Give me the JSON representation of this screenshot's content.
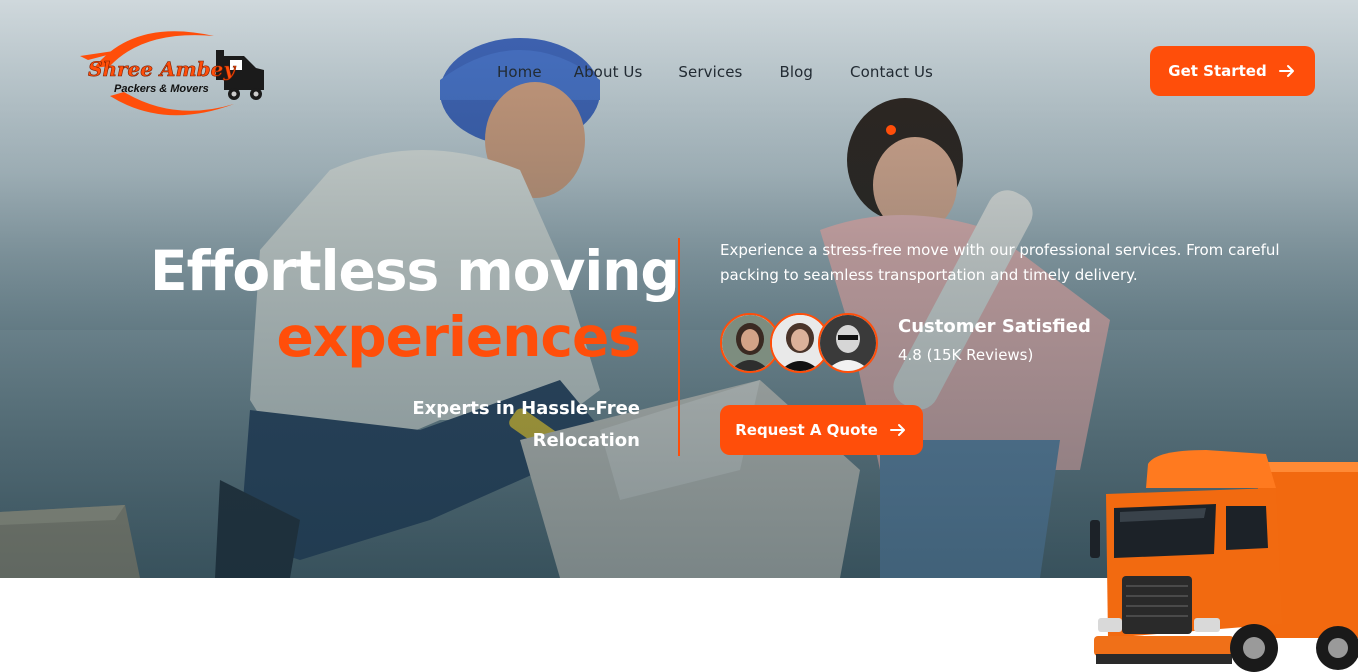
{
  "logo": {
    "line1": "Shree Ambey",
    "line2": "Packers & Movers",
    "icon": "truck-logo-icon"
  },
  "nav": {
    "items": [
      {
        "label": "Home"
      },
      {
        "label": "About Us"
      },
      {
        "label": "Services"
      },
      {
        "label": "Blog"
      },
      {
        "label": "Contact Us"
      }
    ]
  },
  "header": {
    "cta_label": "Get Started",
    "cta_icon": "arrow-right-icon"
  },
  "hero": {
    "headline_line1": "Effortless moving",
    "headline_line2": "experiences",
    "subheadline": "Experts in Hassle-Free Relocation",
    "description": "Experience a stress-free move with our professional services. From careful packing to seamless transportation and timely delivery.",
    "testimonial": {
      "title": "Customer Satisfied",
      "rating": "4.8 (15K Reviews)"
    },
    "quote_button": "Request A Quote",
    "quote_icon": "arrow-right-icon"
  },
  "colors": {
    "accent": "#ff4e0a",
    "text_dark": "#222b33",
    "white": "#ffffff"
  }
}
